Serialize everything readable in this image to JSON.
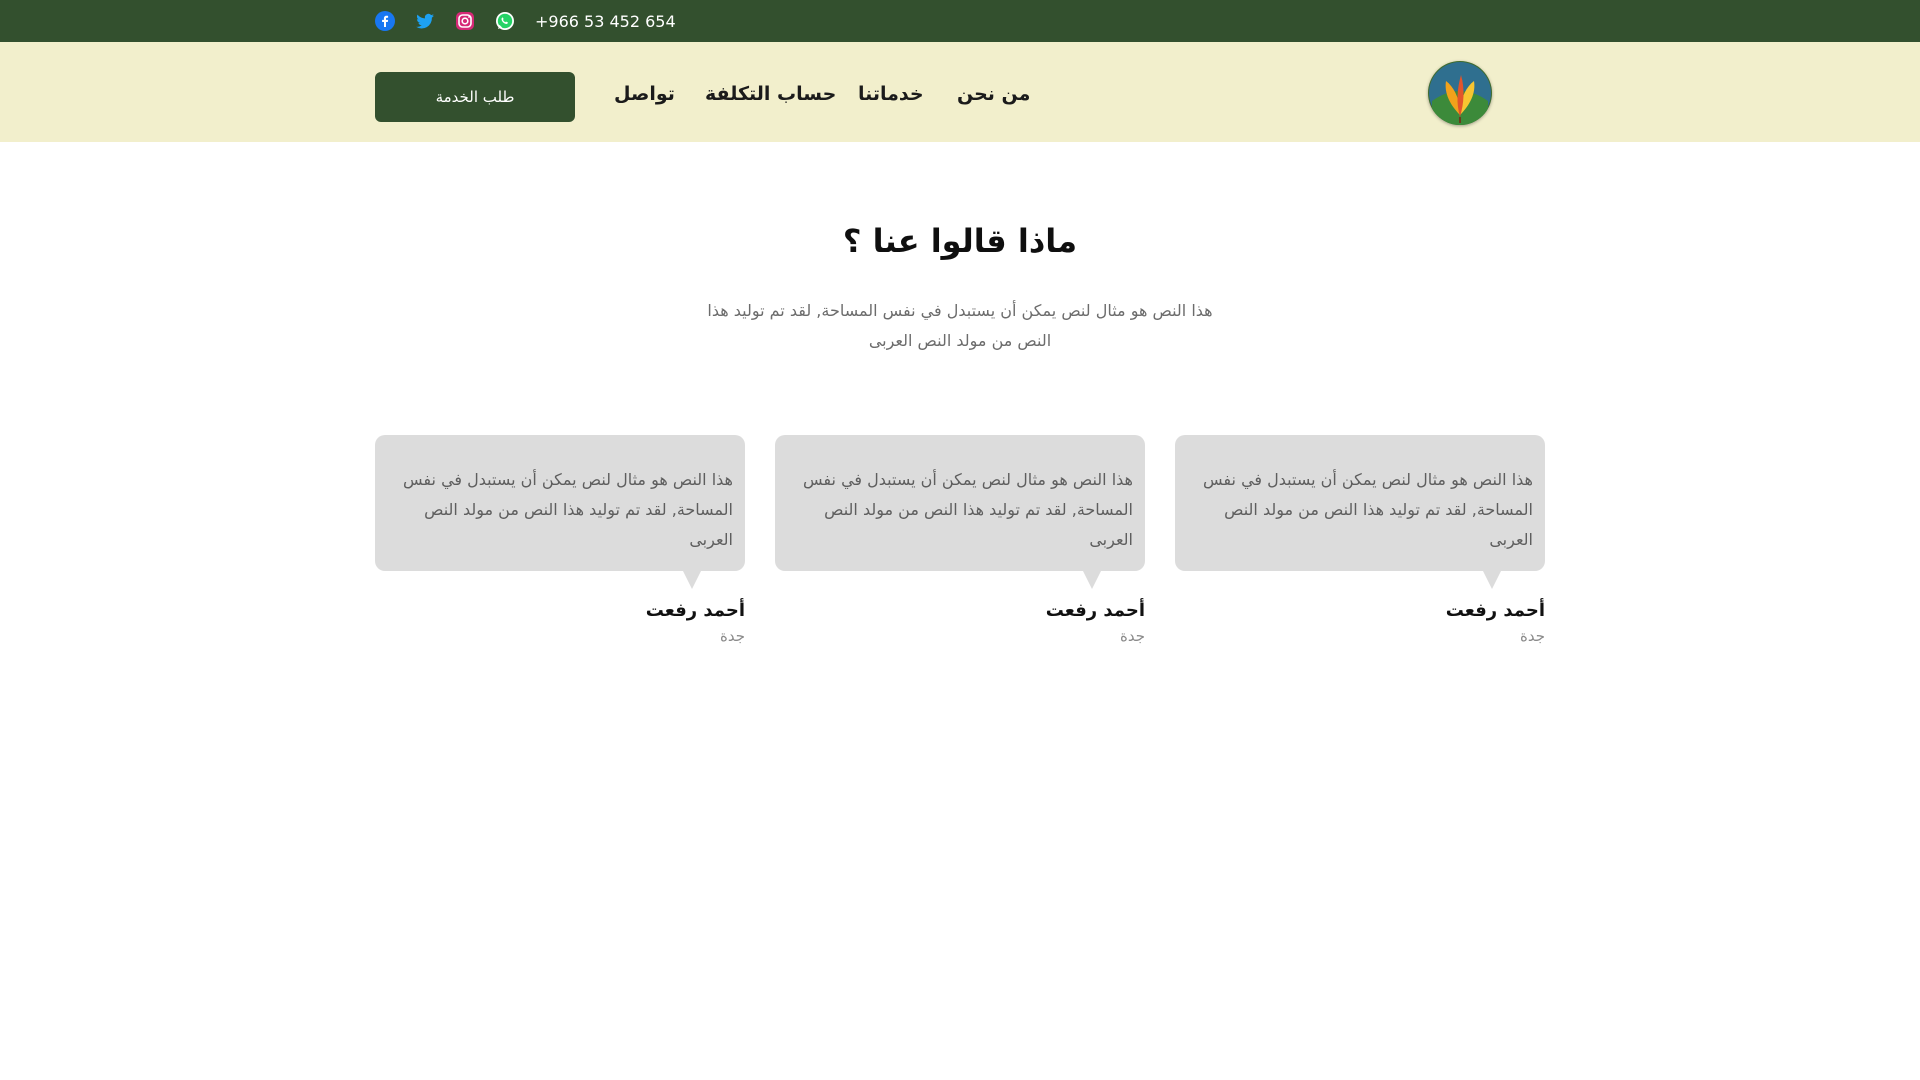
{
  "topbar": {
    "phone": "+966 53 452 654",
    "social": [
      {
        "icon": "facebook-icon",
        "color": "#1877f2"
      },
      {
        "icon": "twitter-icon",
        "color": "#1da1f2"
      },
      {
        "icon": "instagram-icon",
        "color": "#d62976"
      },
      {
        "icon": "whatsapp-icon",
        "color": "#25d366"
      }
    ],
    "background": "#33502e"
  },
  "navbar": {
    "background": "#f2efcc",
    "cta_label": "طلب الخدمة",
    "menu": {
      "contact": "تواصل",
      "cost": "حساب التكلفة",
      "services": "خدماتنا",
      "about": "من نحن"
    },
    "logo_icon": "plant-logo-icon"
  },
  "testimonials": {
    "title": "ماذا قالوا عنا ؟",
    "subtitle": "هذا النص هو مثال لنص يمكن أن يستبدل في نفس المساحة, لقد تم توليد هذا النص من مولد النص العربى",
    "cards": [
      {
        "quote": "هذا النص هو مثال لنص يمكن أن يستبدل في نفس المساحة, لقد تم توليد هذا النص من مولد النص العربى",
        "name": "أحمد رفعت",
        "city": "جدة"
      },
      {
        "quote": "هذا النص هو مثال لنص يمكن أن يستبدل في نفس المساحة, لقد تم توليد هذا النص من مولد النص العربى",
        "name": "أحمد رفعت",
        "city": "جدة"
      },
      {
        "quote": "هذا النص هو مثال لنص يمكن أن يستبدل في نفس المساحة, لقد تم توليد هذا النص من مولد النص العربى",
        "name": "أحمد رفعت",
        "city": "جدة"
      }
    ]
  }
}
